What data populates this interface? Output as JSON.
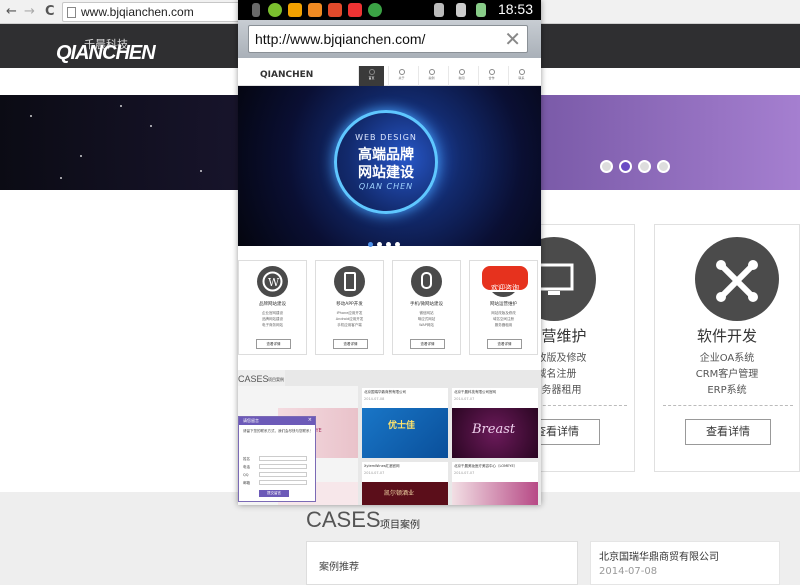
{
  "browser": {
    "url": "www.bjqianchen.com",
    "back": "←",
    "forward": "→",
    "reload": "C"
  },
  "desktop": {
    "logo_cn": "千晨科技",
    "logo_en": "QIANCHEN",
    "card_ops": {
      "title": "运营维护",
      "lines": [
        "站改版及修改",
        "域名注册",
        "服务器租用"
      ],
      "button": "查看详情"
    },
    "card_soft": {
      "title": "软件开发",
      "lines": [
        "企业OA系统",
        "CRM客户管理",
        "ERP系统"
      ],
      "button": "查看详情"
    },
    "cases_title": "CASES",
    "cases_sub": "项目案例",
    "recommend": "案例推荐",
    "company_name": "北京国瑞华鼎商贸有限公司",
    "company_date": "2014-07-08"
  },
  "phone": {
    "time": "18:53",
    "url": "http://www.bjqianchen.com/",
    "clear": "✕",
    "logo": "QIANCHEN",
    "nav": [
      "首页",
      "关于",
      "案例",
      "新闻",
      "合作",
      "联系"
    ],
    "banner": {
      "tagline": "WEB DESIGN",
      "line1": "高端品牌",
      "line2": "网站建设",
      "brand": "QIAN CHEN"
    },
    "cards": [
      {
        "title": "品牌网站建设",
        "lines": [
          "企业官网建设",
          "品牌网站建设",
          "电子商务网站"
        ],
        "button": "查看详情"
      },
      {
        "title": "移动APP开发",
        "lines": [
          "iPhone应用开发",
          "Android应用开发",
          "手机应用客户端"
        ],
        "button": "查看详情"
      },
      {
        "title": "手机/微网站建设",
        "lines": [
          "微信网站",
          "响应式网站",
          "WAP网站"
        ],
        "button": "查看详情"
      },
      {
        "title": "网站运营维护",
        "lines": [
          "网站改版及修改",
          "域名空间注册",
          "服务器租用"
        ],
        "button": "查看详情"
      }
    ],
    "hot_label": "欢迎咨询",
    "cases_title": "CASES",
    "cases_sub": "项目案例",
    "case_items": [
      {
        "name": "北京国瑞华鼎商贸有限公司",
        "date": "2014-07-08"
      },
      {
        "name": "北京千晨科技有限公司官网",
        "date": "2014-07-07"
      },
      {
        "name": "XylemWines红酒官网",
        "date": "2014-07-07"
      },
      {
        "name": "北京千晨美妆医疗美容中心（LOMEYE）",
        "date": "2014-07-07"
      }
    ],
    "pinyin_brand": "优士佳",
    "wine_label": "凯尔顿酒业",
    "breast_label": "Breast",
    "lomeye": "MEYE",
    "popup": {
      "header": "请您留言",
      "hint": "请留下您的联系方式，我们会尽快与您联系！",
      "fields": [
        "姓名",
        "电话",
        "QQ",
        "邮箱"
      ],
      "submit": "提交留言"
    }
  },
  "colors": {
    "dark": "#2f2f31",
    "accent": "#6a4cc4",
    "blue": "#1f5fb4"
  }
}
